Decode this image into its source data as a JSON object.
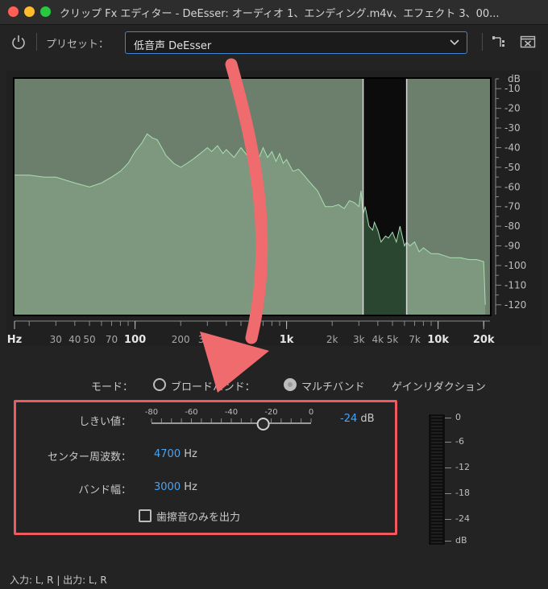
{
  "window": {
    "title": "クリップ Fx エディター - DeEsser: オーディオ 1、エンディング.m4v、エフェクト 3、00..."
  },
  "toolbar": {
    "preset_label": "プリセット：",
    "preset_value": "低音声 DeEsser"
  },
  "spectrum": {
    "db_unit": "dB",
    "db_ticks": [
      "-10",
      "-20",
      "-30",
      "-40",
      "-50",
      "-60",
      "-70",
      "-80",
      "-90",
      "-100",
      "-110",
      "-120"
    ],
    "freq_ticks": [
      {
        "label": "Hz",
        "hz": 16,
        "major": true
      },
      {
        "label": "30",
        "hz": 30,
        "major": false
      },
      {
        "label": "40",
        "hz": 40,
        "major": false
      },
      {
        "label": "50",
        "hz": 50,
        "major": false
      },
      {
        "label": "70",
        "hz": 70,
        "major": false
      },
      {
        "label": "100",
        "hz": 100,
        "major": true
      },
      {
        "label": "200",
        "hz": 200,
        "major": false
      },
      {
        "label": "300",
        "hz": 300,
        "major": false
      },
      {
        "label": "1k",
        "hz": 1000,
        "major": true
      },
      {
        "label": "2k",
        "hz": 2000,
        "major": false
      },
      {
        "label": "3k",
        "hz": 3000,
        "major": false
      },
      {
        "label": "4k",
        "hz": 4000,
        "major": false
      },
      {
        "label": "5k",
        "hz": 5000,
        "major": false
      },
      {
        "label": "7k",
        "hz": 7000,
        "major": false
      },
      {
        "label": "10k",
        "hz": 10000,
        "major": true
      },
      {
        "label": "20k",
        "hz": 20000,
        "major": true
      }
    ],
    "band_low_hz": 3200,
    "band_high_hz": 6200,
    "colors": {
      "fill": "#7f9a81",
      "fill_band": "#2a4630",
      "line": "#a9dfb0",
      "backdrop": "#6b7f6c",
      "band_bg": "#0c0c0c"
    }
  },
  "chart_data": {
    "type": "area",
    "x_scale": "log",
    "xlim": [
      16,
      22000
    ],
    "ylim": [
      -125,
      -5
    ],
    "ylabel": "dB",
    "x": [
      16,
      20,
      25,
      30,
      40,
      50,
      60,
      70,
      80,
      90,
      100,
      110,
      120,
      130,
      140,
      150,
      160,
      170,
      180,
      200,
      220,
      240,
      260,
      280,
      300,
      320,
      350,
      380,
      400,
      450,
      500,
      550,
      600,
      650,
      700,
      750,
      800,
      850,
      900,
      950,
      1000,
      1100,
      1200,
      1300,
      1400,
      1600,
      1800,
      2000,
      2200,
      2400,
      2600,
      2800,
      3000,
      3100,
      3200,
      3300,
      3500,
      3700,
      3800,
      4000,
      4200,
      4500,
      4700,
      5000,
      5300,
      5600,
      6000,
      6200,
      6500,
      7000,
      7500,
      8000,
      9000,
      10000,
      11000,
      12000,
      14000,
      16000,
      18000,
      20000,
      20500
    ],
    "y": [
      -54,
      -54,
      -55,
      -55,
      -58,
      -60,
      -58,
      -55,
      -52,
      -48,
      -42,
      -38,
      -33,
      -35,
      -36,
      -40,
      -44,
      -46,
      -48,
      -50,
      -48,
      -46,
      -44,
      -42,
      -40,
      -42,
      -39,
      -43,
      -41,
      -45,
      -40,
      -44,
      -38,
      -46,
      -40,
      -45,
      -42,
      -47,
      -43,
      -48,
      -46,
      -52,
      -51,
      -54,
      -57,
      -62,
      -70,
      -70,
      -69,
      -71,
      -67,
      -68,
      -70,
      -62,
      -74,
      -70,
      -80,
      -82,
      -78,
      -82,
      -88,
      -85,
      -86,
      -83,
      -88,
      -80,
      -90,
      -88,
      -90,
      -88,
      -93,
      -91,
      -94,
      -94,
      -95,
      -96,
      -96,
      -97,
      -97,
      -98,
      -120
    ]
  },
  "mode": {
    "label": "モード：",
    "option_broadband": "ブロードバンド：",
    "option_multiband": "マルチバンド",
    "gain_reduction_label": "ゲインリダクション",
    "selected": "multiband"
  },
  "params": {
    "threshold_label": "しきい値：",
    "threshold_value": "-24",
    "threshold_unit": "dB",
    "threshold_scale": [
      "-80",
      "-60",
      "-40",
      "-20",
      "0"
    ],
    "threshold_slider": {
      "min": -80,
      "max": 0,
      "value": -24
    },
    "center_label": "センター周波数：",
    "center_value": "4700",
    "center_unit": "Hz",
    "bandwidth_label": "バンド幅：",
    "bandwidth_value": "3000",
    "bandwidth_unit": "Hz",
    "output_sibilance_label": "歯擦音のみを出力"
  },
  "gain_meter": {
    "ticks": [
      "0",
      "-6",
      "-12",
      "-18",
      "-24",
      "dB"
    ]
  },
  "status": {
    "io": "入力: L, R | 出力: L, R"
  },
  "colors": {
    "accent": "#3d86d6",
    "value_blue": "#4aa3f0",
    "highlight": "#ee5a60",
    "arrow": "#f06b6e"
  }
}
